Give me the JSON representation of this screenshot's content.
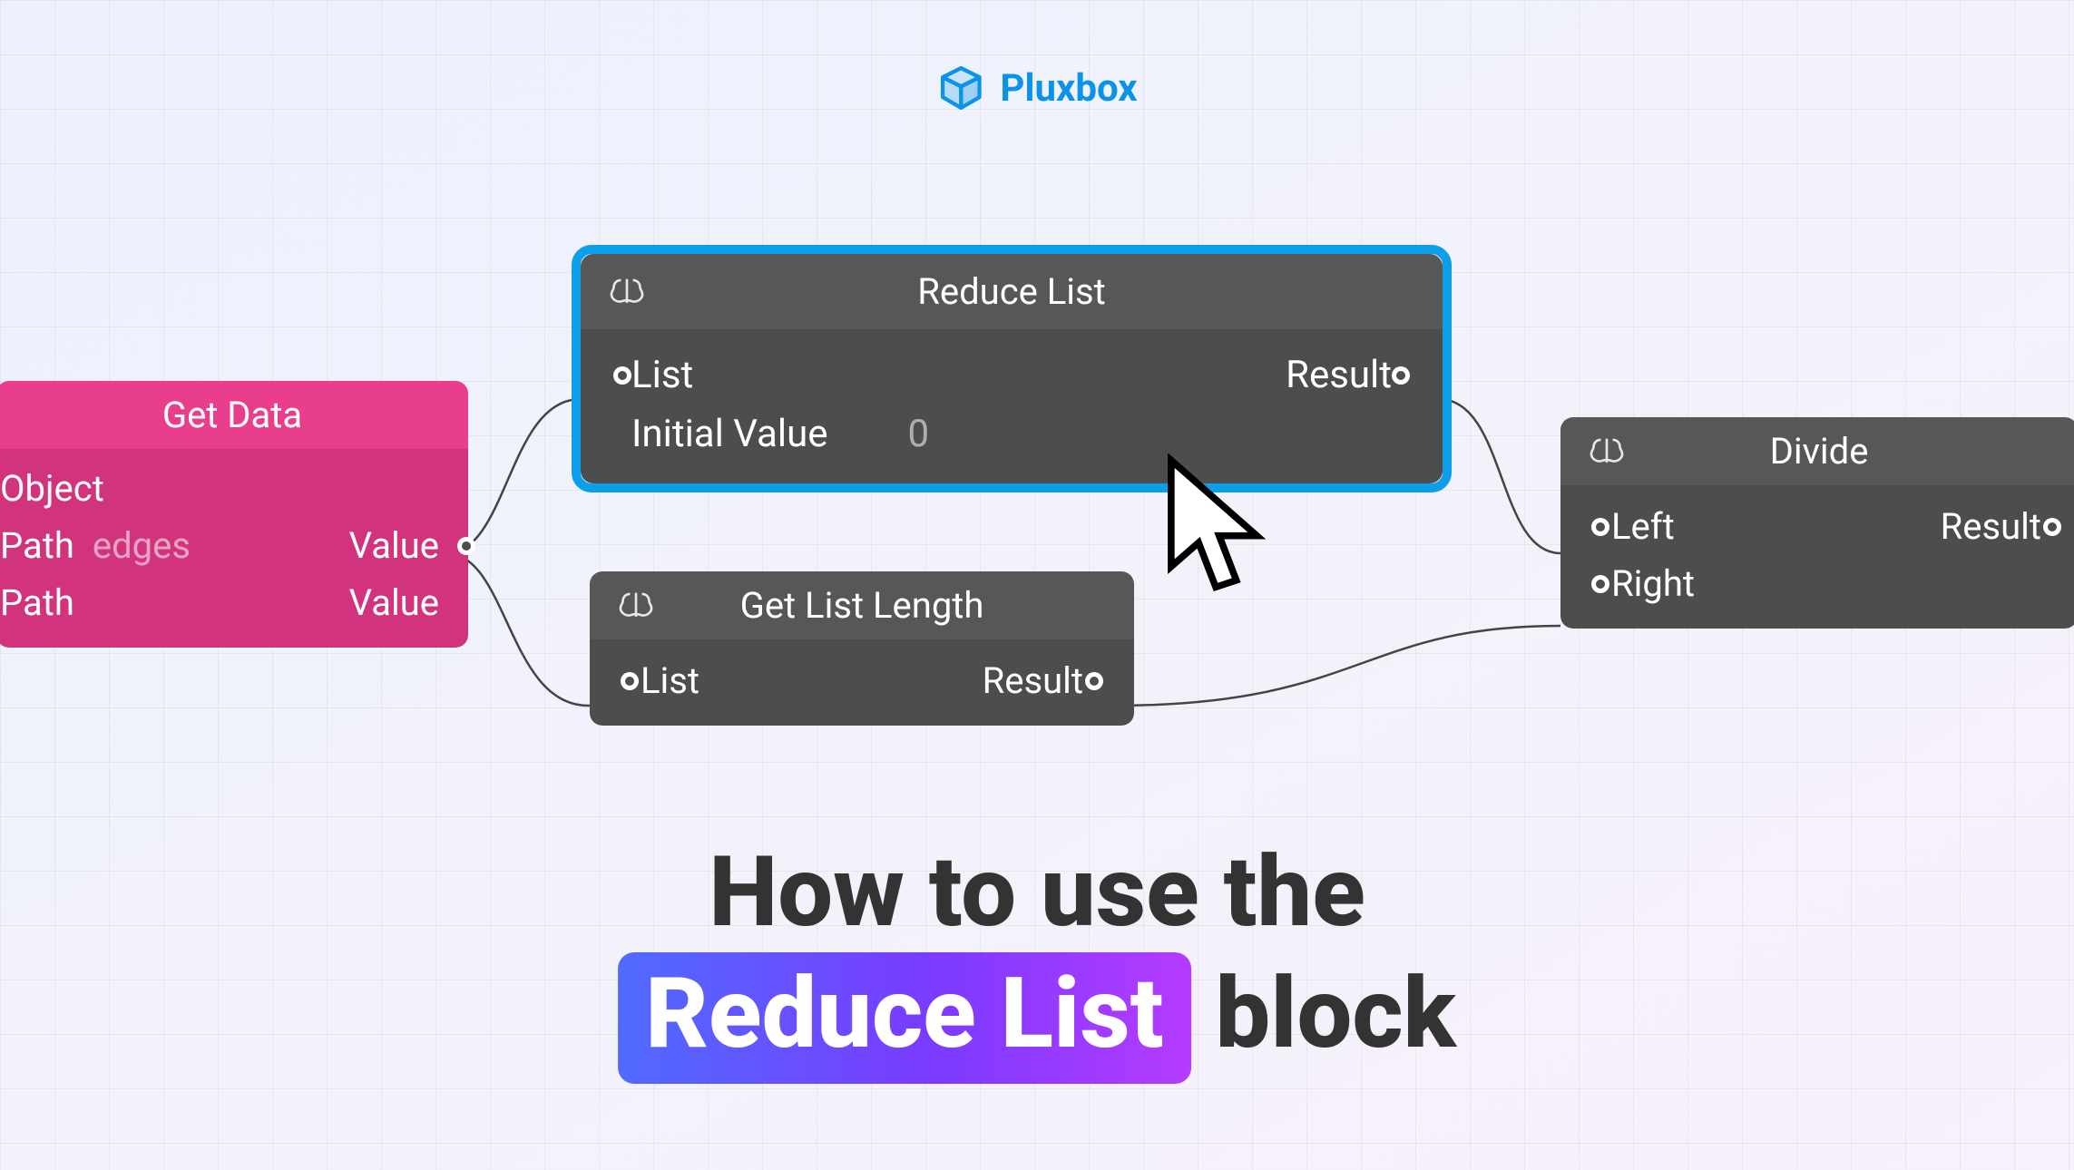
{
  "brand": {
    "name": "Pluxbox"
  },
  "nodes": {
    "getdata": {
      "title": "Get Data",
      "rows": [
        {
          "label": "Object"
        },
        {
          "label": "Path",
          "value": "edges",
          "out": "Value"
        },
        {
          "label": "Path",
          "out": "Value"
        }
      ]
    },
    "reduce": {
      "title": "Reduce List",
      "rows": [
        {
          "in": "List",
          "out": "Result"
        },
        {
          "in": "Initial Value",
          "value": "0"
        }
      ]
    },
    "length": {
      "title": "Get List Length",
      "row": {
        "in": "List",
        "out": "Result"
      }
    },
    "divide": {
      "title": "Divide",
      "rows": [
        {
          "in": "Left",
          "out": "Result"
        },
        {
          "in": "Right"
        }
      ]
    }
  },
  "title": {
    "line1": "How to use the",
    "chip": "Reduce List",
    "line2_after": "block"
  },
  "colors": {
    "accent": "#0a9fe8",
    "pink": "#e83e8c",
    "node": "#4d4d4d"
  }
}
